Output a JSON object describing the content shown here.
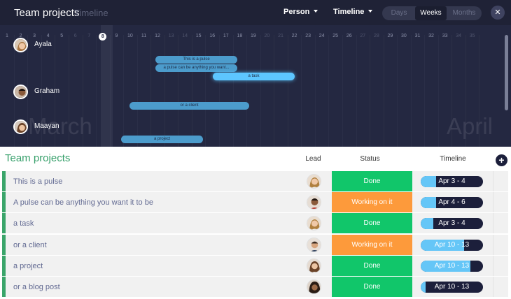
{
  "header": {
    "title": "Team projects",
    "view": "Timeline",
    "person_label": "Person",
    "timeline_label": "Timeline",
    "scale": [
      "Days",
      "Weeks",
      "Months"
    ],
    "active_scale": "Weeks"
  },
  "timeline": {
    "days": [
      "1",
      "2",
      "3",
      "4",
      "5",
      "6",
      "7",
      "8",
      "9",
      "10",
      "11",
      "12",
      "13",
      "14",
      "15",
      "16",
      "17",
      "18",
      "19",
      "20",
      "21",
      "22",
      "23",
      "24",
      "25",
      "26",
      "27",
      "28",
      "29",
      "30",
      "31",
      "32",
      "33",
      "34",
      "35"
    ],
    "weekend_days": [
      "6",
      "7",
      "13",
      "14",
      "20",
      "21",
      "27",
      "28",
      "34",
      "35"
    ],
    "today": "8",
    "months": [
      "March",
      "April"
    ],
    "people": [
      "Ayala",
      "Graham",
      "Maayan"
    ],
    "bars": [
      "This is a pulse",
      "a pulse can be anything you want...",
      "a task",
      "or a client",
      "a project"
    ]
  },
  "board": {
    "title": "Team projects",
    "columns": {
      "lead": "Lead",
      "status": "Status",
      "timeline": "Timeline"
    },
    "rows": [
      {
        "name": "This is a pulse",
        "status": "Done",
        "timeline": "Apr 3 - 4",
        "progress": 0.25
      },
      {
        "name": "A pulse can be anything you want it to be",
        "status": "Working on it",
        "timeline": "Apr 4 - 6",
        "progress": 0.25
      },
      {
        "name": "a task",
        "status": "Done",
        "timeline": "Apr 3 - 4",
        "progress": 0.2
      },
      {
        "name": "or a client",
        "status": "Working on it",
        "timeline": "Apr 10 - 13",
        "progress": 0.7
      },
      {
        "name": "a project",
        "status": "Done",
        "timeline": "Apr 10 - 13",
        "progress": 0.8
      },
      {
        "name": "or a blog post",
        "status": "Done",
        "timeline": "Apr 10 - 13",
        "progress": 0.08
      }
    ]
  },
  "colors": {
    "header_bg": "#1f2236",
    "timeline_bg": "#242841",
    "done": "#11c66a",
    "working": "#fd9a3b",
    "group": "#3aa56a",
    "timeline_fill": "#65c6f7"
  }
}
